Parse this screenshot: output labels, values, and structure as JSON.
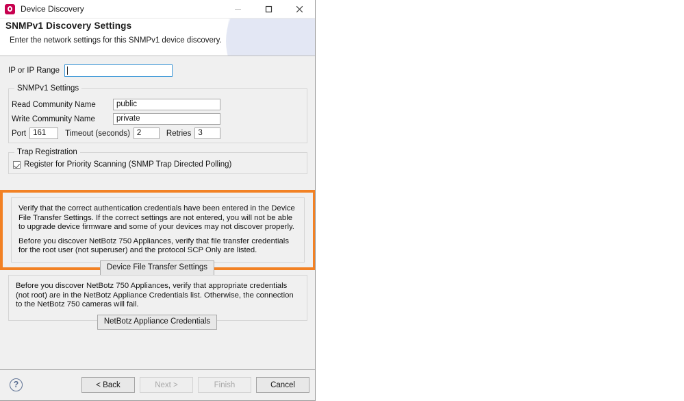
{
  "window": {
    "title": "Device Discovery",
    "icon": "app-icon",
    "controls": {
      "minimize": "minimize-icon",
      "maximize": "maximize-icon",
      "close": "close-icon"
    }
  },
  "header": {
    "title": "SNMPv1 Discovery Settings",
    "subtitle": "Enter the network settings for this SNMPv1 device discovery."
  },
  "ip": {
    "label": "IP or IP Range",
    "value": "",
    "placeholder": ""
  },
  "snmp_group": {
    "title": "SNMPv1 Settings",
    "read_community": {
      "label": "Read Community Name",
      "value": "public"
    },
    "write_community": {
      "label": "Write Community Name",
      "value": "private"
    },
    "port": {
      "label": "Port",
      "value": "161"
    },
    "timeout": {
      "label": "Timeout (seconds)",
      "value": "2"
    },
    "retries": {
      "label": "Retries",
      "value": "3"
    }
  },
  "trap_group": {
    "title": "Trap Registration",
    "checkbox_label": "Register for Priority Scanning (SNMP Trap Directed Polling)",
    "checked": true
  },
  "file_transfer_panel": {
    "highlight_color": "#f28124",
    "paragraph1": "Verify that the correct authentication credentials have been entered in the Device File Transfer Settings. If the correct settings are not entered, you will not be able to upgrade device firmware and some of your devices may not discover properly.",
    "paragraph2": "Before you discover NetBotz 750 Appliances, verify that file transfer credentials for the root user (not superuser) and the protocol SCP Only are listed.",
    "button_label": "Device File Transfer Settings"
  },
  "netbotz_panel": {
    "paragraph": "Before you discover NetBotz 750 Appliances, verify that appropriate credentials (not root) are in the NetBotz Appliance Credentials list. Otherwise, the connection to the NetBotz 750 cameras will fail.",
    "button_label": "NetBotz Appliance Credentials"
  },
  "footer": {
    "help_icon": "help-icon",
    "buttons": [
      {
        "label": "< Back",
        "enabled": true
      },
      {
        "label": "Next >",
        "enabled": false
      },
      {
        "label": "Finish",
        "enabled": false
      },
      {
        "label": "Cancel",
        "enabled": true
      }
    ]
  }
}
